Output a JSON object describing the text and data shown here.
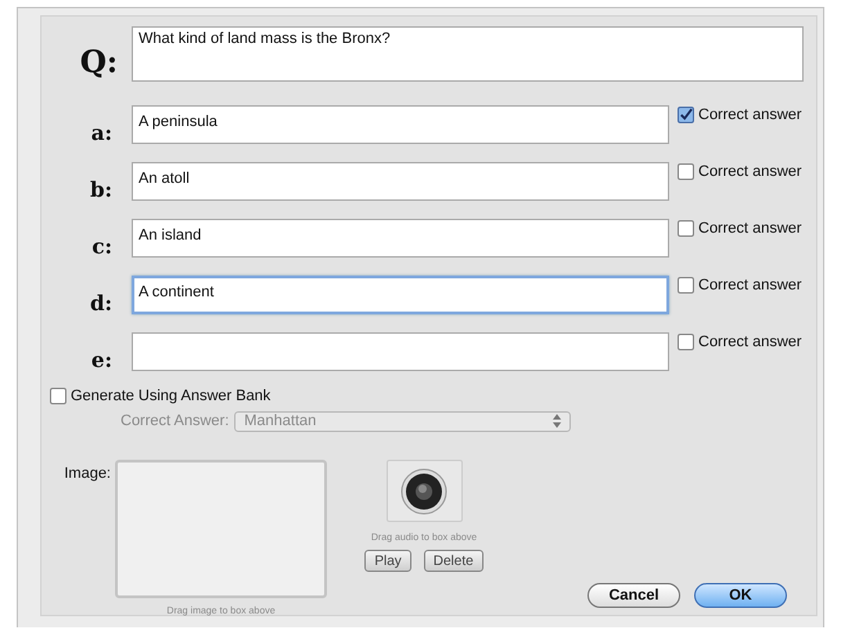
{
  "question": {
    "label": "Q:",
    "value": "What kind of land mass is the Bronx?"
  },
  "answers": [
    {
      "label": "a:",
      "value": "A peninsula",
      "focused": false,
      "correct_label": "Correct answer",
      "checked": true
    },
    {
      "label": "b:",
      "value": "An atoll",
      "focused": false,
      "correct_label": "Correct answer",
      "checked": false
    },
    {
      "label": "c:",
      "value": "An island",
      "focused": false,
      "correct_label": "Correct answer",
      "checked": false
    },
    {
      "label": "d:",
      "value": "A continent",
      "focused": true,
      "correct_label": "Correct answer",
      "checked": false
    },
    {
      "label": "e:",
      "focused": false,
      "correct_label": "Correct answer",
      "checked": false
    }
  ],
  "answer_bank": {
    "label": "Generate Using Answer Bank",
    "checked": false,
    "correct_answer_label": "Correct Answer:",
    "correct_answer_value": "Manhattan",
    "disabled": true
  },
  "image": {
    "label": "Image:",
    "caption": "Drag image to box above"
  },
  "audio": {
    "caption": "Drag audio to box above",
    "buttons": [
      "Play",
      "Delete"
    ]
  },
  "buttons": [
    {
      "label": "Cancel",
      "default": false
    },
    {
      "label": "OK",
      "default": true
    }
  ]
}
